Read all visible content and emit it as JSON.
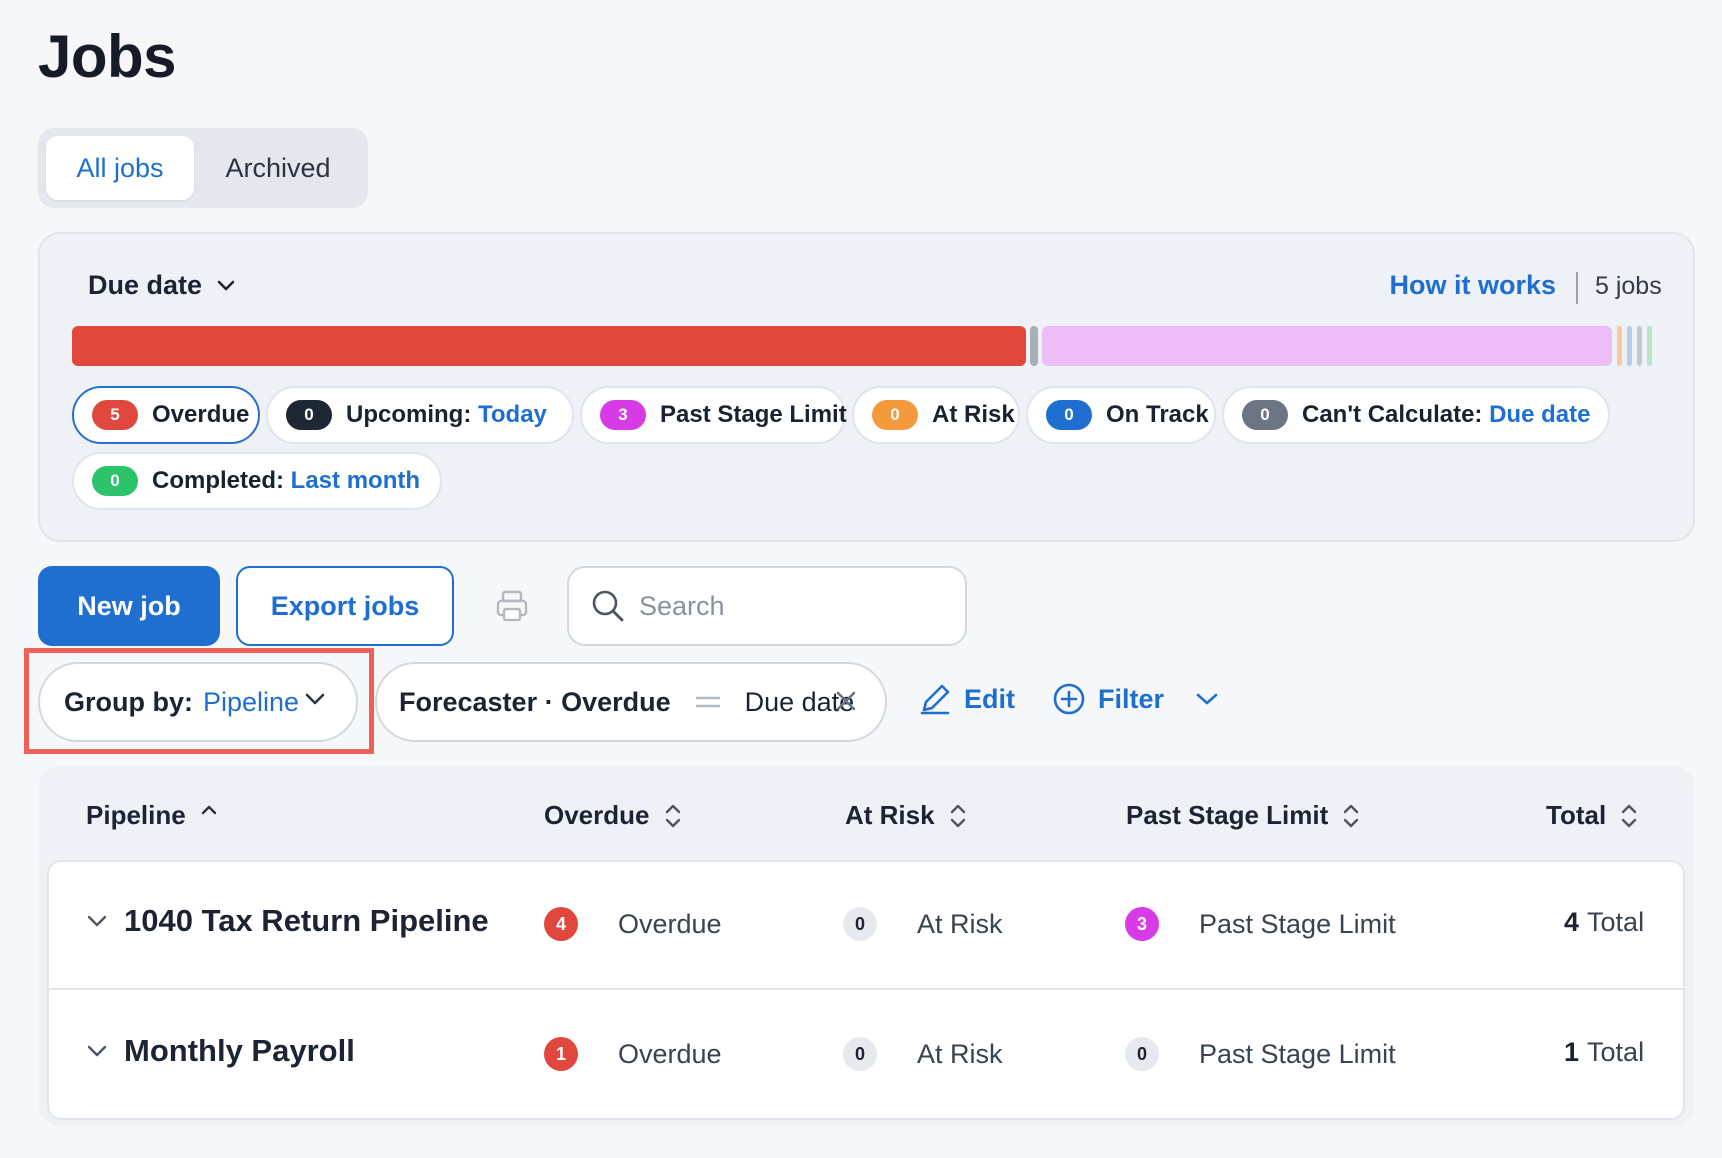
{
  "page": {
    "title": "Jobs"
  },
  "tabs": [
    {
      "label": "All jobs",
      "active": true
    },
    {
      "label": "Archived",
      "active": false
    }
  ],
  "forecast": {
    "sort_label": "Due date",
    "how_it_works": "How it works",
    "jobs_count": "5 jobs",
    "bar_shares": {
      "overdue": 5,
      "past_stage_limit": 3
    },
    "chips": [
      {
        "count": "5",
        "label": "Overdue",
        "color": "#e0483d",
        "selected": true
      },
      {
        "count": "0",
        "label": "Upcoming:",
        "value": "Today",
        "color": "#1e2733"
      },
      {
        "count": "3",
        "label": "Past Stage Limit",
        "color": "#d63be6"
      },
      {
        "count": "0",
        "label": "At Risk",
        "color": "#f59a3c"
      },
      {
        "count": "0",
        "label": "On Track",
        "color": "#1f6fd0"
      },
      {
        "count": "0",
        "label": "Can't Calculate:",
        "value": "Due date",
        "color": "#6b7584"
      },
      {
        "count": "0",
        "label": "Completed:",
        "value": "Last month",
        "color": "#2cc46a"
      }
    ]
  },
  "actions": {
    "new_job": "New job",
    "export_jobs": "Export jobs",
    "search_placeholder": "Search"
  },
  "filters": {
    "group_by_label": "Group by:",
    "group_by_value": "Pipeline",
    "filter_field": "Forecaster · Overdue",
    "filter_value": "Due date",
    "edit_label": "Edit",
    "filter_label": "Filter"
  },
  "table": {
    "columns": [
      "Pipeline",
      "Overdue",
      "At Risk",
      "Past Stage Limit",
      "Total"
    ],
    "rows": [
      {
        "name": "1040 Tax Return Pipeline",
        "overdue": "4",
        "overdue_label": "Overdue",
        "at_risk": "0",
        "at_risk_label": "At Risk",
        "past": "3",
        "past_label": "Past Stage Limit",
        "total": "4",
        "total_label": "Total"
      },
      {
        "name": "Monthly Payroll",
        "overdue": "1",
        "overdue_label": "Overdue",
        "at_risk": "0",
        "at_risk_label": "At Risk",
        "past": "0",
        "past_label": "Past Stage Limit",
        "total": "1",
        "total_label": "Total"
      }
    ]
  },
  "colors": {
    "accent": "#1f6fd0",
    "overdue": "#e0483d",
    "past_stage": "#d63be6",
    "highlight": "#f0605a"
  }
}
